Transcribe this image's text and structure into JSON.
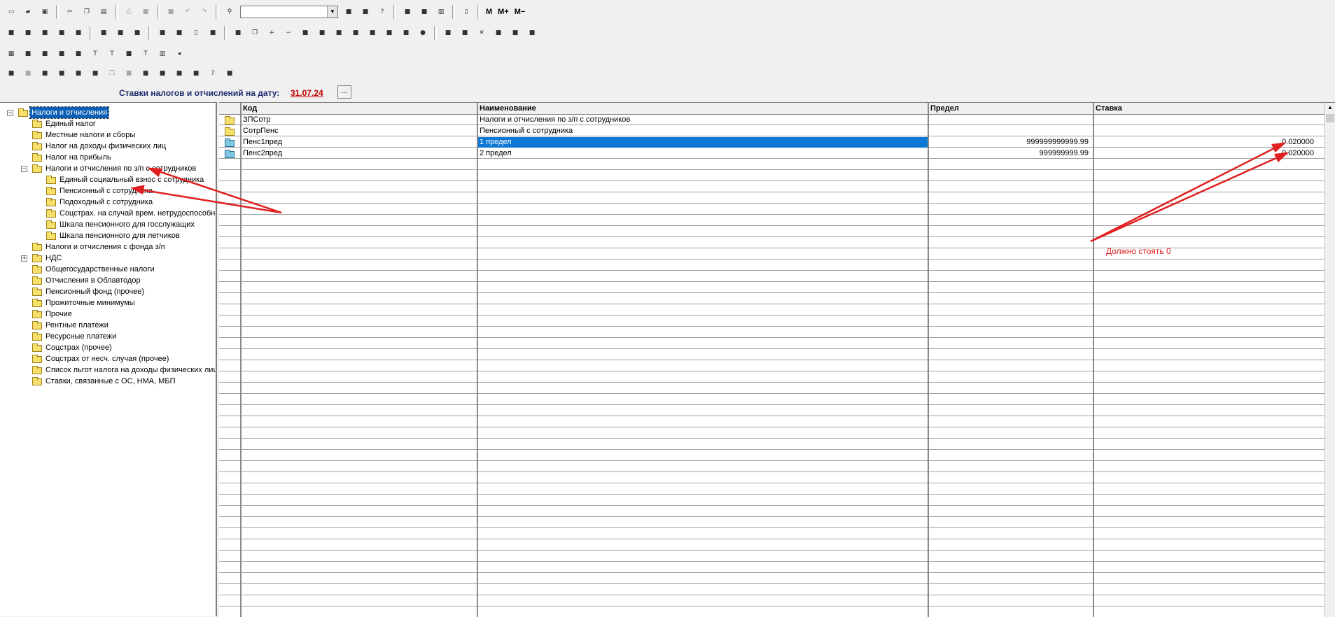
{
  "toolbar": {
    "combo_value": "",
    "m_label": "M",
    "m_plus_label": "M+",
    "m_minus_label": "M−",
    "row1_icons": [
      "new-icon",
      "open-icon",
      "save-icon",
      "cut-icon",
      "copy-icon",
      "paste-icon",
      "print-icon",
      "print-preview-icon",
      "form-icon",
      "undo-icon",
      "redo-icon",
      "find-icon"
    ],
    "row1_after_combo": [
      "find-next-icon",
      "find-replace-icon",
      "help-icon",
      "calculator-icon",
      "calendar-icon",
      "chart-icon",
      "book-icon"
    ],
    "row2_icons": [
      "ledger-icon",
      "reports-icon",
      "journal-icon",
      "register-icon",
      "tools-icon",
      "tmp-icon",
      "clock-icon",
      "sd-icon",
      "table-icon",
      "account-icon",
      "book2-icon",
      "plat-icon",
      "binder-icon",
      "copy2-icon",
      "plus-icon",
      "minus-icon",
      "vsplit-icon",
      "hsplit-icon",
      "link-icon",
      "n-icon",
      "n2-icon",
      "note-icon",
      "cash-icon",
      "globe-icon",
      "pin-icon",
      "pin2-icon",
      "cross-icon",
      "grid2-icon",
      "grid3-icon",
      "grid4-icon"
    ],
    "row3_icons": [
      "calc-icon",
      "checker-icon",
      "docs-icon",
      "doc2-icon",
      "doc3-icon",
      "t-icon",
      "t2-icon",
      "doc4-icon",
      "t3-icon",
      "chart2-icon",
      "back-icon"
    ],
    "row4_icons": [
      "tb4-a-icon",
      "tb4-folder-icon",
      "tb4-grid-icon",
      "tb4-search-icon",
      "tb4-edit-icon",
      "tb4-delete-icon",
      "tb4-copy-icon",
      "tb4-link-icon",
      "tb4-multi-icon",
      "tb4-doc-icon",
      "tb4-refresh-icon",
      "tb4-tree-icon",
      "tb4-help-icon",
      "tb4-whatis-icon"
    ]
  },
  "date_bar": {
    "label": "Ставки налогов и отчислений на дату:",
    "date": "31.07.24",
    "button": "..."
  },
  "tree": {
    "items": [
      {
        "label": "Налоги и отчисления",
        "level": 0,
        "expander": "−",
        "selected": true
      },
      {
        "label": "Единый налог",
        "level": 1
      },
      {
        "label": "Местные налоги и сборы",
        "level": 1
      },
      {
        "label": "Налог на доходы физических лиц",
        "level": 1
      },
      {
        "label": "Налог на прибыль",
        "level": 1
      },
      {
        "label": "Налоги и отчисления по з/п с сотрудников",
        "level": 1,
        "expander": "−"
      },
      {
        "label": "Единый социальный взнос с сотрудника",
        "level": 2
      },
      {
        "label": "Пенсионный с сотрудника",
        "level": 2,
        "open": true
      },
      {
        "label": "Подоходный с сотрудника",
        "level": 2
      },
      {
        "label": "Соцстрах. на случай врем. нетрудоспособнс",
        "level": 2
      },
      {
        "label": "Шкала пенсионного для госслужащих",
        "level": 2
      },
      {
        "label": "Шкала пенсионного для летчиков",
        "level": 2
      },
      {
        "label": "Налоги и отчисления с фонда з/п",
        "level": 1
      },
      {
        "label": "НДС",
        "level": 1,
        "expander": "+"
      },
      {
        "label": "Общегосударственные налоги",
        "level": 1
      },
      {
        "label": "Отчисления в Облавтодор",
        "level": 1
      },
      {
        "label": "Пенсионный фонд (прочее)",
        "level": 1
      },
      {
        "label": "Прожиточные минимумы",
        "level": 1
      },
      {
        "label": "Прочие",
        "level": 1
      },
      {
        "label": "Рентные платежи",
        "level": 1
      },
      {
        "label": "Ресурсные платежи",
        "level": 1
      },
      {
        "label": "Соцстрах (прочее)",
        "level": 1
      },
      {
        "label": "Соцстрах от несч. случая (прочее)",
        "level": 1
      },
      {
        "label": "Список льгот налога на доходы физических лиц",
        "level": 1
      },
      {
        "label": "Ставки, связанные с ОС, НМА, МБП",
        "level": 1
      }
    ]
  },
  "grid": {
    "columns": [
      "Код",
      "Наименование",
      "Предел",
      "Ставка"
    ],
    "rows": [
      {
        "type": "folder",
        "code": "ЗПСотр",
        "name": "Налоги и отчисления по з/п с сотрудников",
        "limit": "",
        "rate": ""
      },
      {
        "type": "folder",
        "code": "СотрПенс",
        "name": "Пенсионный с сотрудника",
        "limit": "",
        "rate": ""
      },
      {
        "type": "item",
        "code": "Пенс1пред",
        "name": "1 предел",
        "limit": "999999999999.99",
        "rate": "0.020000",
        "selected": true
      },
      {
        "type": "item",
        "code": "Пенс2пред",
        "name": "2 предел",
        "limit": "999999999.99",
        "rate": "0.020000"
      }
    ]
  },
  "annotation": {
    "text": "Должно стоять 0",
    "color": "#e02020"
  }
}
